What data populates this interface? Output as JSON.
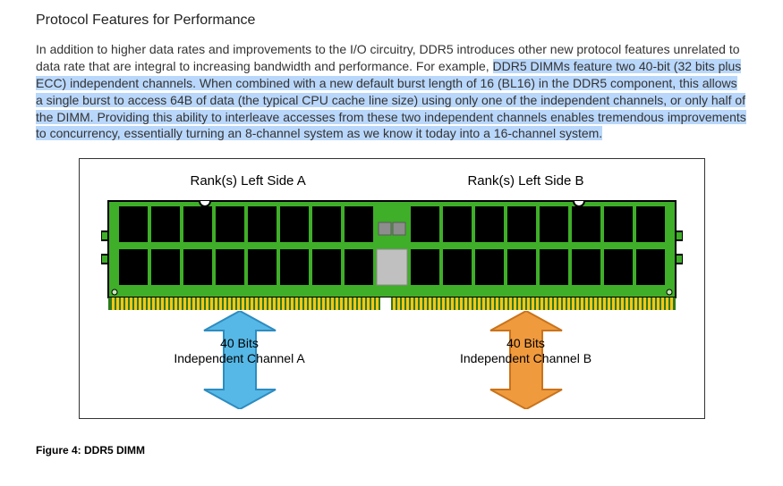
{
  "section_title": "Protocol Features for Performance",
  "paragraph": {
    "lead": "In addition to higher data rates and improvements to the I/O circuitry, DDR5 introduces other new protocol features unrelated to data rate that are integral to increasing bandwidth and performance. For example, ",
    "highlighted": "DDR5 DIMMs feature two 40-bit (32 bits plus ECC) independent channels. When combined with a new default burst length of 16 (BL16) in the DDR5 component, this allows a single burst to access 64B of data (the typical CPU cache line size) using only one of the independent channels, or only half of the DIMM. Providing this ability to interleave accesses from these two independent channels enables tremendous improvements to concurrency, essentially turning an 8-channel system as we know it today into a 16-channel system."
  },
  "figure": {
    "rank_left_a": "Rank(s) Left Side A",
    "rank_left_b": "Rank(s) Left Side B",
    "channel_a": {
      "bits": "40 Bits",
      "name": "Independent Channel A"
    },
    "channel_b": {
      "bits": "40 Bits",
      "name": "Independent Channel B"
    },
    "caption": "Figure 4: DDR5 DIMM",
    "colors": {
      "pcb": "#3fae29",
      "pcb_edge": "#2d7a1e",
      "chip": "#000000",
      "pmic_small": "#8d8d8d",
      "pmic_large": "#c0c0c0",
      "pins": "#f6c518",
      "arrow_a": "#56b8e6",
      "arrow_b": "#f09a3e"
    }
  }
}
